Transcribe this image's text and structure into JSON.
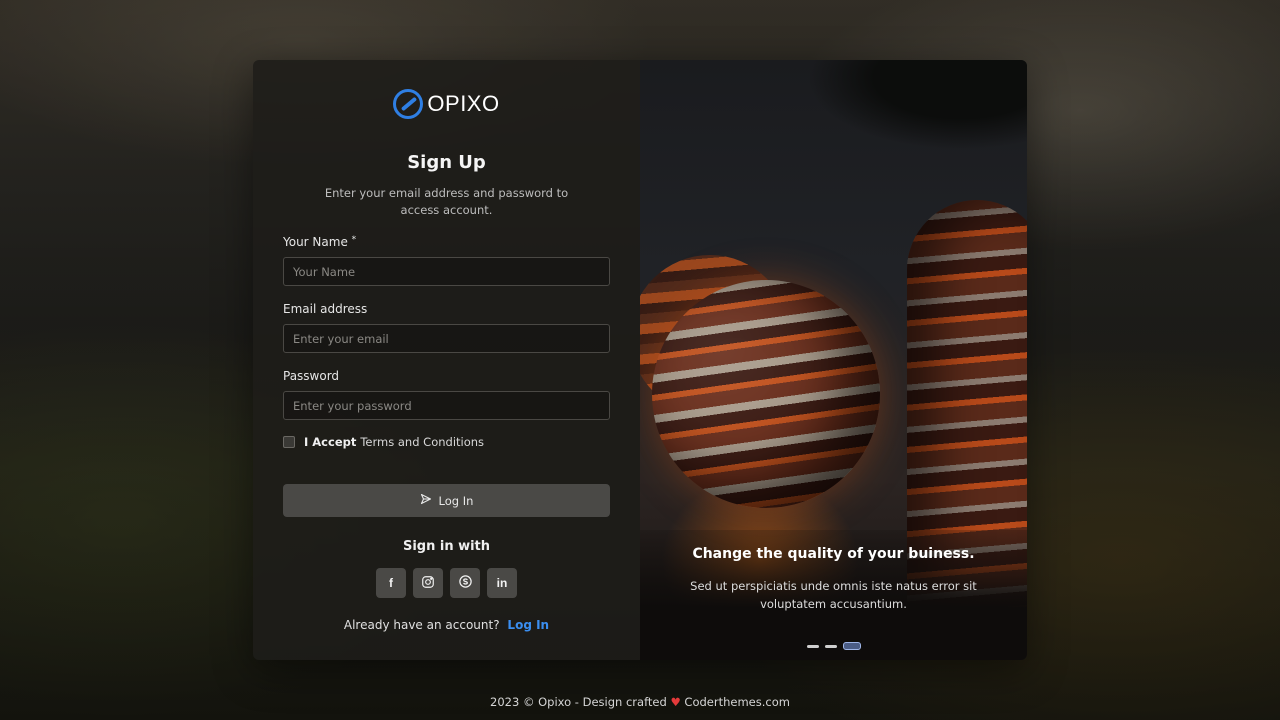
{
  "brand": {
    "name": "OPIXO"
  },
  "form": {
    "title": "Sign Up",
    "subtitle": "Enter your email address and password to access account.",
    "name_label": "Your Name",
    "name_required_mark": "*",
    "name_placeholder": "Your Name",
    "email_label": "Email address",
    "email_placeholder": "Enter your email",
    "password_label": "Password",
    "password_placeholder": "Enter your password",
    "terms_bold": "I Accept",
    "terms_rest": "Terms and Conditions",
    "terms_checked": false,
    "submit_label": "Log In"
  },
  "social": {
    "heading": "Sign in with",
    "items": [
      {
        "icon": "facebook-icon",
        "glyph": "f"
      },
      {
        "icon": "instagram-icon",
        "glyph": "◎"
      },
      {
        "icon": "skype-icon",
        "glyph": "S"
      },
      {
        "icon": "linkedin-icon",
        "glyph": "in"
      }
    ]
  },
  "account": {
    "prompt": "Already have an account?",
    "link": "Log In"
  },
  "carousel": {
    "title": "Change the quality of your buiness.",
    "description": "Sed ut perspiciatis unde omnis iste natus error sit voluptatem accusantium.",
    "slide_count": 3,
    "active_index": 2
  },
  "footer": {
    "prefix": "2023 © Opixo - Design crafted",
    "heart": "♥",
    "suffix": "Coderthemes.com"
  },
  "colors": {
    "accent": "#3a8ef0",
    "logo_blue": "#2f7fe4",
    "button_bg": "#4a4946",
    "heart": "#e43a3a"
  }
}
